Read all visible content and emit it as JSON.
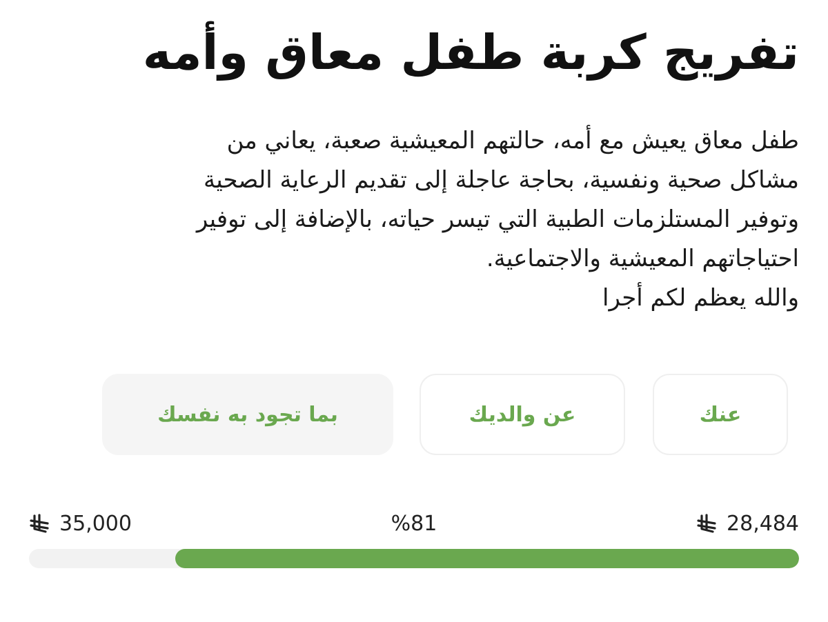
{
  "campaign": {
    "title": "تفريج كربة طفل معاق وأمه",
    "description_lines": [
      "طفل معاق يعيش مع أمه، حالتهم المعيشية صعبة، يعاني من",
      "مشاكل صحية ونفسية، بحاجة عاجلة إلى تقديم الرعاية الصحية",
      "وتوفير المستلزمات الطبية التي تيسر حياته، بالإضافة إلى توفير",
      "احتياجاتهم المعيشية والاجتماعية.",
      "والله يعظم لكم أجرا"
    ]
  },
  "donation_options": [
    {
      "label": "عنك"
    },
    {
      "label": "عن والديك"
    },
    {
      "label": "بما تجود به نفسك"
    }
  ],
  "progress": {
    "collected": "28,484",
    "target": "35,000",
    "percent_label": "%81",
    "fraction": 0.81,
    "currency_icon": "riyal-icon",
    "fill_color": "#6aa84f",
    "track_color": "#f2f2f2"
  },
  "colors": {
    "accent": "#6aa84f",
    "text": "#111111"
  }
}
